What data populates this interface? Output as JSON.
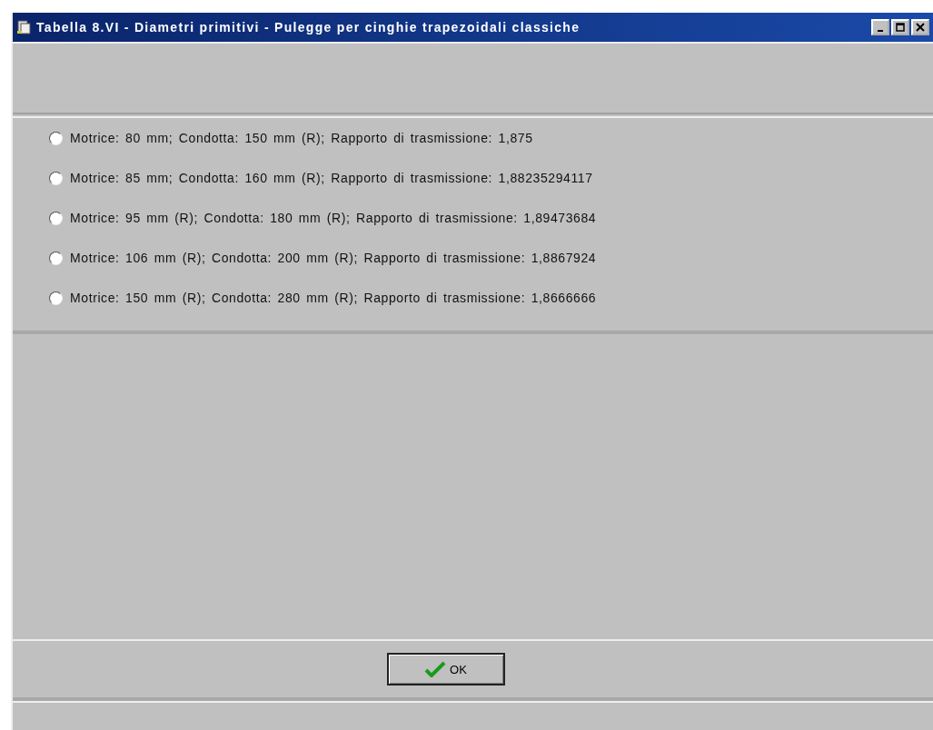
{
  "window": {
    "title": "Tabella 8.VI - Diametri primitivi - Pulegge per cinghie trapezoidali classiche"
  },
  "options": [
    {
      "label": "Motrice: 80 mm; Condotta: 150 mm (R); Rapporto di trasmissione: 1,875",
      "selected": false
    },
    {
      "label": "Motrice: 85 mm; Condotta: 160 mm (R); Rapporto di trasmissione: 1,88235294117",
      "selected": false
    },
    {
      "label": "Motrice: 95 mm (R); Condotta: 180 mm (R); Rapporto di trasmissione: 1,89473684",
      "selected": false
    },
    {
      "label": "Motrice: 106 mm (R); Condotta: 200 mm (R); Rapporto di trasmissione: 1,8867924",
      "selected": false
    },
    {
      "label": "Motrice: 150 mm (R); Condotta: 280 mm (R); Rapporto di trasmissione: 1,8666666",
      "selected": false
    }
  ],
  "buttons": [
    {
      "label": "OK"
    }
  ]
}
